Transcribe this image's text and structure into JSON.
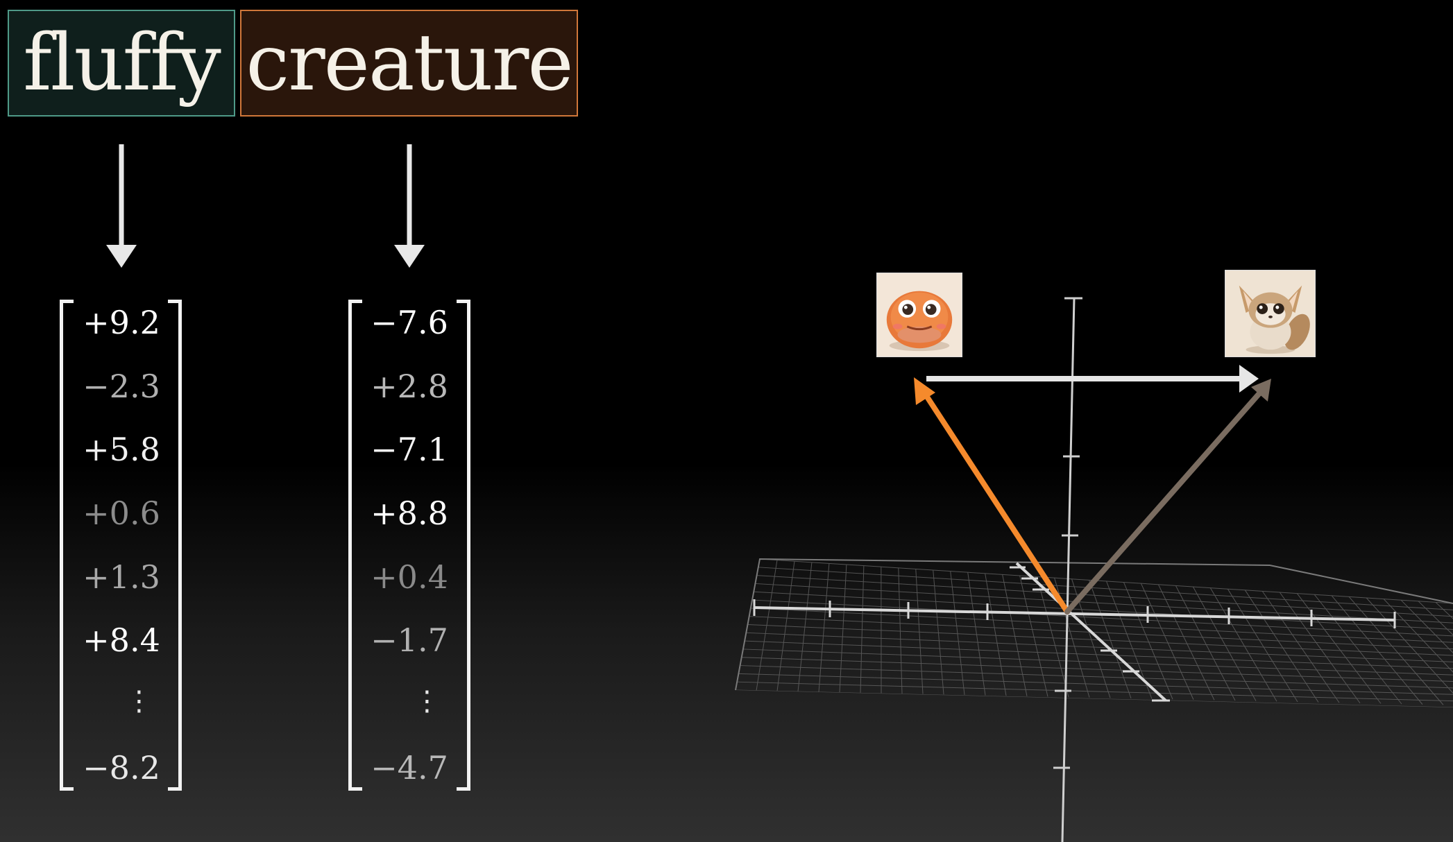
{
  "tokens": {
    "fluffy": "fluffy",
    "creature": "creature"
  },
  "vectors": {
    "fluffy": [
      "+9.2",
      "−2.3",
      "+5.8",
      "+0.6",
      "+1.3",
      "+8.4",
      "−8.2"
    ],
    "creature": [
      "−7.6",
      "+2.8",
      "−7.1",
      "+8.8",
      "+0.4",
      "−1.7",
      "−4.7"
    ],
    "ellipsis": "⋮"
  },
  "images": {
    "left": "orange-creature-icon",
    "right": "fluffy-fox-creature-icon"
  },
  "colors": {
    "fluffy_border": "#4f9a88",
    "creature_border": "#d0773a",
    "orange_arrow": "#f58a2c",
    "brown_arrow": "#7a6c60",
    "white_arrow": "#e6e6e6"
  }
}
